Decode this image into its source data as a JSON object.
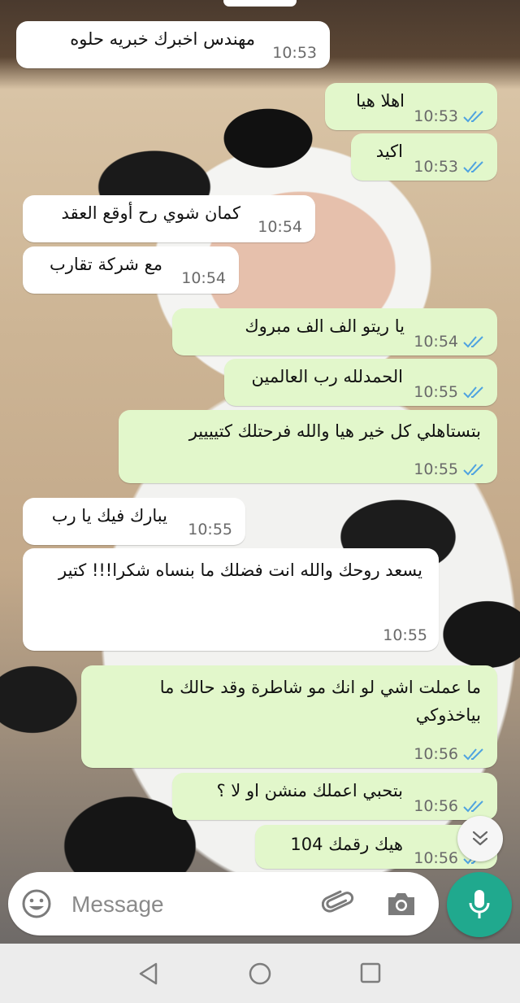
{
  "chat": {
    "messages": [
      {
        "text": "مهندس اخبرك خبريه حلوه",
        "time": "10:53",
        "dir": "in"
      },
      {
        "text": "اهلا هيا",
        "time": "10:53",
        "dir": "out"
      },
      {
        "text": "اكيد",
        "time": "10:53",
        "dir": "out"
      },
      {
        "text": "كمان شوي رح أوقع العقد",
        "time": "10:54",
        "dir": "in"
      },
      {
        "text": "مع شركة تقارب",
        "time": "10:54",
        "dir": "in"
      },
      {
        "text": "يا ريتو الف الف مبروك",
        "time": "10:54",
        "dir": "out"
      },
      {
        "text": "الحمدلله رب العالمين",
        "time": "10:55",
        "dir": "out"
      },
      {
        "text": "بتستاهلي كل خير هيا والله فرحتلك كتيييير",
        "time": "10:55",
        "dir": "out"
      },
      {
        "text": "يبارك فيك يا رب",
        "time": "10:55",
        "dir": "in"
      },
      {
        "text": "يسعد روحك والله انت فضلك ما بنساه شكرا!!! كتير",
        "time": "10:55",
        "dir": "in"
      },
      {
        "text": "ما عملت اشي لو انك مو شاطرة وقد حالك ما بياخذوكي",
        "time": "10:56",
        "dir": "out"
      },
      {
        "text": "بتحبي اعملك منشن او لا ؟",
        "time": "10:56",
        "dir": "out"
      },
      {
        "text": "هيك رقمك 104",
        "time": "10:56",
        "dir": "out"
      }
    ]
  },
  "composer": {
    "placeholder": "Message",
    "icons": {
      "emoji": "emoji-icon",
      "attach": "paperclip-icon",
      "camera": "camera-icon",
      "mic": "microphone-icon"
    }
  },
  "scroll_down_icon": "double-chevron-down-icon",
  "navbar": {
    "back": "back-triangle-icon",
    "home": "home-circle-icon",
    "recents": "recents-square-icon"
  },
  "colors": {
    "incoming_bubble": "#ffffff",
    "outgoing_bubble": "#e2f7cb",
    "read_ticks": "#4fa3e0",
    "accent": "#20a98e"
  }
}
